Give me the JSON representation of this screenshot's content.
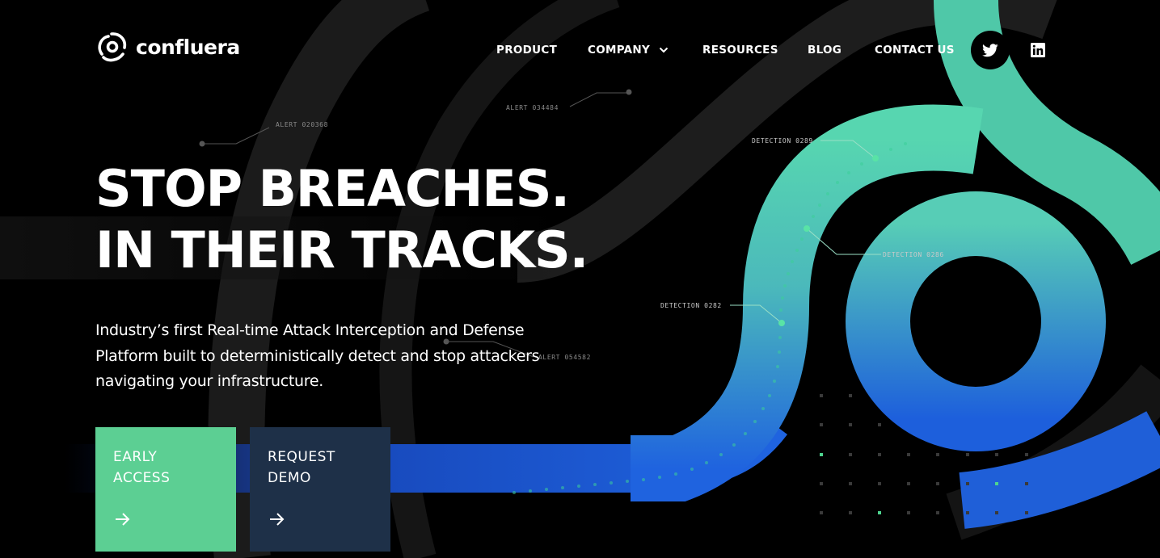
{
  "brand": {
    "name": "confluera"
  },
  "nav": {
    "items": [
      {
        "label": "PRODUCT"
      },
      {
        "label": "COMPANY"
      },
      {
        "label": "RESOURCES"
      },
      {
        "label": "BLOG"
      },
      {
        "label": "CONTACT US"
      }
    ],
    "social": [
      "twitter-icon",
      "linkedin-icon"
    ]
  },
  "hero": {
    "headline_line1": "STOP BREACHES.",
    "headline_line2": "IN THEIR TRACKS.",
    "description": "Industry’s first Real-time Attack Interception and Defense Platform built to deterministically detect and stop attackers navigating your infrastructure."
  },
  "cta": {
    "early_access": "EARLY ACCESS",
    "request_demo": "REQUEST DEMO"
  },
  "graphic_labels": {
    "alert_1": "ALERT 020368",
    "alert_2": "ALERT 034484",
    "alert_3": "ALERT 054582",
    "detection_1": "DETECTION 0289",
    "detection_2": "DETECTION 0286",
    "detection_3": "DETECTION 0282"
  },
  "colors": {
    "accent_green": "#5ccf93",
    "cta_dark": "#1e3048",
    "ring_teal": "#57c7b0",
    "ring_blue": "#1f64e0"
  }
}
